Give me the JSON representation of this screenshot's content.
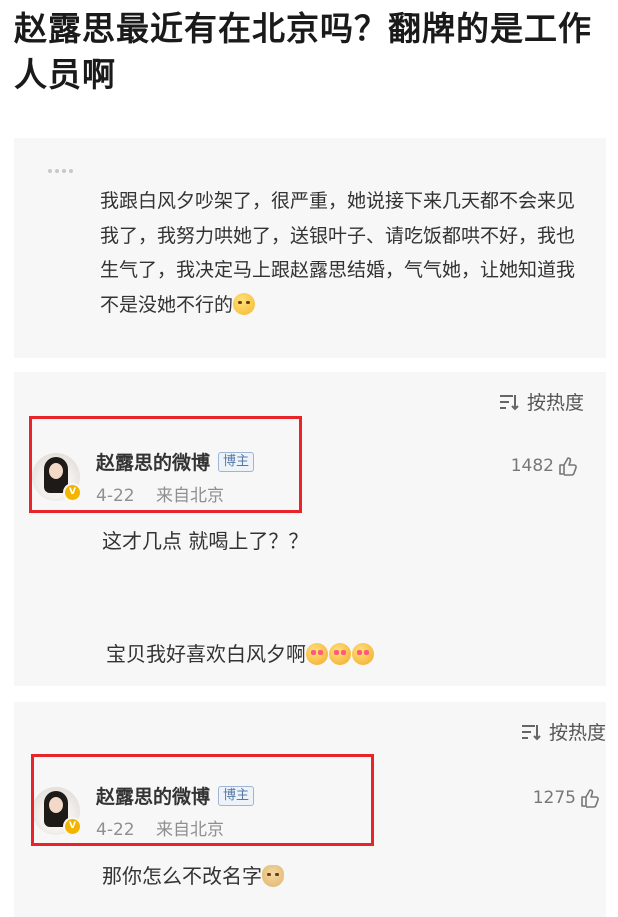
{
  "headline": "赵露思最近有在北京吗？翻牌的是工作人员啊",
  "post": {
    "text": "我跟白风夕吵架了，很严重，她说接下来几天都不会来见我了，我努力哄她了，送银叶子、请吃饭都哄不好，我也生气了，我决定马上跟赵露思结婚，气气她，让她知道我不是没她不行的"
  },
  "comments": [
    {
      "sort_label": "按热度",
      "user_name": "赵露思的微博",
      "badge": "博主",
      "date": "4-22",
      "location": "来自北京",
      "likes": "1482",
      "text": "这才几点 就喝上了？？",
      "second_text": "宝贝我好喜欢白风夕啊"
    },
    {
      "sort_label": "按热度",
      "user_name": "赵露思的微博",
      "badge": "博主",
      "date": "4-22",
      "location": "来自北京",
      "likes": "1275",
      "text": "那你怎么不改名字"
    }
  ],
  "icons": {
    "sort": "sort-icon",
    "like": "thumb-up-icon",
    "verified": "verified-badge-icon",
    "emoji": "emoji-icon"
  },
  "colors": {
    "highlight": "#e8232a",
    "badge_text": "#5578a6",
    "verified": "#f3b400",
    "card_bg": "#f7f7f7"
  }
}
